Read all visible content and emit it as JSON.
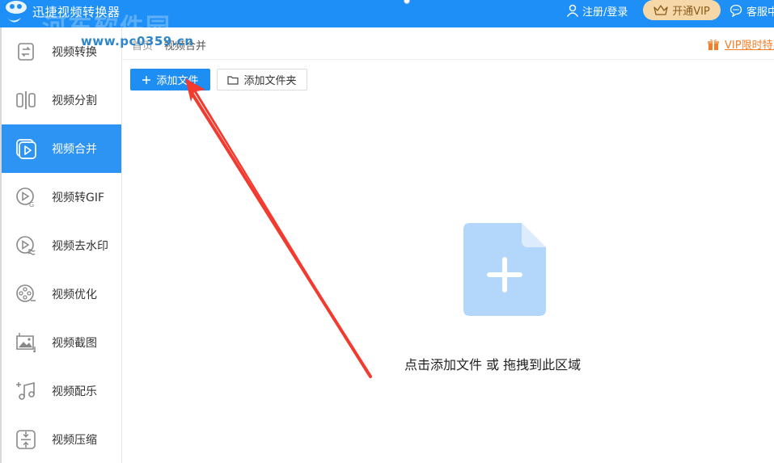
{
  "titlebar": {
    "app_title": "迅捷视频转换器",
    "watermark_text": "河东软件园",
    "watermark_url": "www.pc0359.cn",
    "user_label": "注册/登录",
    "vip_label": "开通VIP",
    "service_label": "客服中",
    "bar_color": "#1e8ff6"
  },
  "sidebar": {
    "items": [
      {
        "label": "视频转换",
        "icon": "convert-icon"
      },
      {
        "label": "视频分割",
        "icon": "split-icon"
      },
      {
        "label": "视频合并",
        "icon": "merge-play-icon",
        "active": true
      },
      {
        "label": "视频转GIF",
        "icon": "gif-icon"
      },
      {
        "label": "视频去水印",
        "icon": "watermark-remove-icon"
      },
      {
        "label": "视频优化",
        "icon": "film-reel-icon"
      },
      {
        "label": "视频截图",
        "icon": "screenshot-icon"
      },
      {
        "label": "视频配乐",
        "icon": "music-icon"
      },
      {
        "label": "视频压缩",
        "icon": "compress-icon"
      }
    ],
    "active_color": "#2e94f4"
  },
  "breadcrumb": {
    "home": "首页",
    "separator": ">",
    "current": "视频合并"
  },
  "promo": {
    "label": "VIP限时特惠",
    "color": "#f07e2a"
  },
  "toolbar": {
    "add_file": "添加文件",
    "add_folder": "添加文件夹"
  },
  "dropzone": {
    "text": "点击添加文件 或 拖拽到此区域",
    "icon_color": "#b3d6fb"
  },
  "annotation": {
    "arrow_color": "#f23a2f"
  }
}
